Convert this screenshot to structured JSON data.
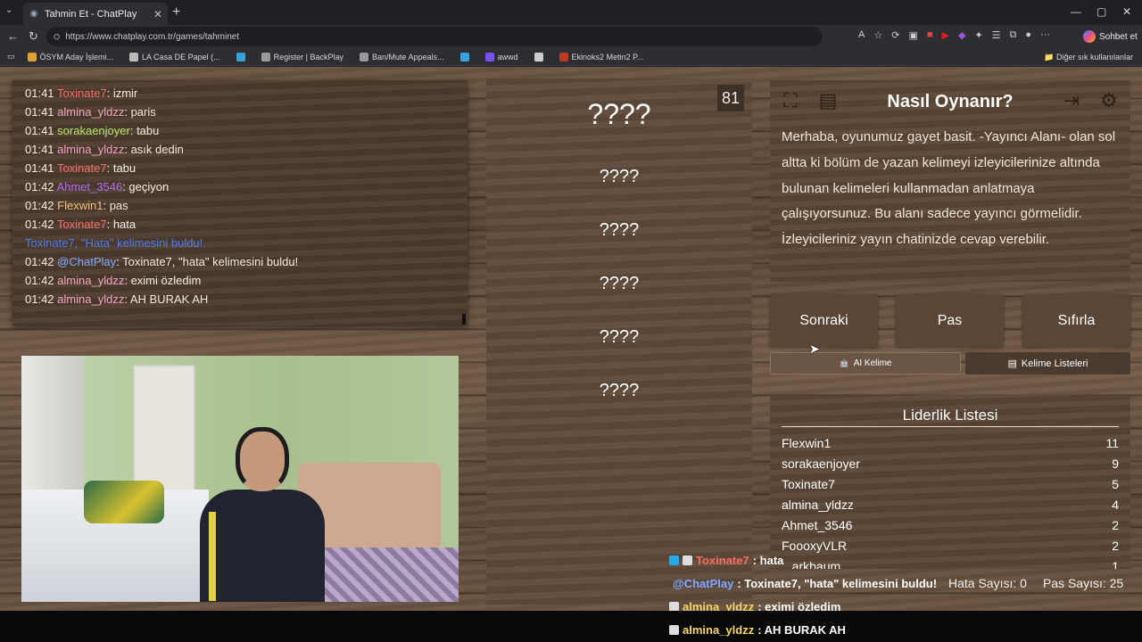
{
  "browser": {
    "tab_title": "Tahmin Et - ChatPlay",
    "url": "https://www.chatplay.com.tr/games/tahminet",
    "chat_button": "Sohbet et",
    "bookmarks": [
      {
        "label": "ÖSYM Aday İşlemi...",
        "color": "#e0a030"
      },
      {
        "label": "LA Casa DE Papel (...",
        "color": "#bbbbbb"
      },
      {
        "label": "",
        "color": "#3aa0d8"
      },
      {
        "label": "Register | BackPlay",
        "color": "#999999"
      },
      {
        "label": "Ban/Mute Appeals...",
        "color": "#999999"
      },
      {
        "label": "",
        "color": "#3aa0d8"
      },
      {
        "label": "awwd",
        "color": "#7b4ff0"
      },
      {
        "label": "",
        "color": "#cccccc"
      },
      {
        "label": "Ekinoks2 Metin2 P...",
        "color": "#c0392b"
      }
    ],
    "other_bookmarks": "Diğer sık kullanılanlar"
  },
  "chat": [
    {
      "time": "01:41",
      "user": "Toxinate7",
      "color": "#ff6b6b",
      "msg": "izmir"
    },
    {
      "time": "01:41",
      "user": "almina_yldzz",
      "color": "#f1a7c4",
      "msg": "paris"
    },
    {
      "time": "01:41",
      "user": "sorakaenjoyer",
      "color": "#b5e86b",
      "msg": "tabu"
    },
    {
      "time": "01:41",
      "user": "almina_yldzz",
      "color": "#f1a7c4",
      "msg": "asık dedin"
    },
    {
      "time": "01:41",
      "user": "Toxinate7",
      "color": "#ff6b6b",
      "msg": "tabu"
    },
    {
      "time": "01:42",
      "user": "Ahmet_3546",
      "color": "#b06cf0",
      "msg": "geçiyon"
    },
    {
      "time": "01:42",
      "user": "Flexwin1",
      "color": "#f2c27a",
      "msg": "pas"
    },
    {
      "time": "01:42",
      "user": "Toxinate7",
      "color": "#ff6b6b",
      "msg": "hata"
    },
    {
      "system": "Toxinate7, \"Hata\" kelimesini buldu!."
    },
    {
      "time": "01:42",
      "user": "@ChatPlay",
      "color": "#7fa8ff",
      "msg": "Toxinate7, \"hata\" kelimesini buldu!"
    },
    {
      "time": "01:42",
      "user": "almina_yldzz",
      "color": "#f1a7c4",
      "msg": "eximi özledim"
    },
    {
      "time": "01:42",
      "user": "almina_yldzz",
      "color": "#f1a7c4",
      "msg": "AH BURAK AH"
    }
  ],
  "game": {
    "timer": "81",
    "main_word": "????",
    "forbidden_words": [
      "????",
      "????",
      "????",
      "????",
      "????"
    ]
  },
  "howto": {
    "title": "Nasıl Oynanır?",
    "text": "Merhaba, oyunumuz gayet basit. -Yayıncı Alanı- olan sol altta ki bölüm de yazan kelimeyi izleyicilerinize altında bulunan kelimeleri kullanmadan anlatmaya çalışıyorsunuz. Bu alanı sadece yayıncı görmelidir. İzleyicileriniz yayın chatinizde cevap verebilir."
  },
  "buttons": {
    "next": "Sonraki",
    "pass": "Pas",
    "reset": "Sıfırla",
    "ai_word": "AI Kelime",
    "word_lists": "Kelime Listeleri"
  },
  "leaderboard": {
    "title": "Liderlik Listesi",
    "rows": [
      {
        "name": "Flexwin1",
        "score": "11"
      },
      {
        "name": "sorakaenjoyer",
        "score": "9"
      },
      {
        "name": "Toxinate7",
        "score": "5"
      },
      {
        "name": "almina_yldzz",
        "score": "4"
      },
      {
        "name": "Ahmet_3546",
        "score": "2"
      },
      {
        "name": "FoooxyVLR",
        "score": "2"
      },
      {
        "name": "...arkbaum",
        "score": "1"
      }
    ]
  },
  "overlay": {
    "msg1_user": "Toxinate7",
    "msg1_text": ": hata",
    "msg2_user": "@ChatPlay",
    "msg2_text": ": Toxinate7, \"hata\" kelimesini buldu!",
    "msg3_user": "almina_yldzz",
    "msg3_text": ": eximi özledim",
    "msg4_user": "almina_yldzz",
    "msg4_text": ": AH BURAK AH",
    "error_count": "Hata Sayısı: 0",
    "pass_count": "Pas Sayısı: 25"
  }
}
